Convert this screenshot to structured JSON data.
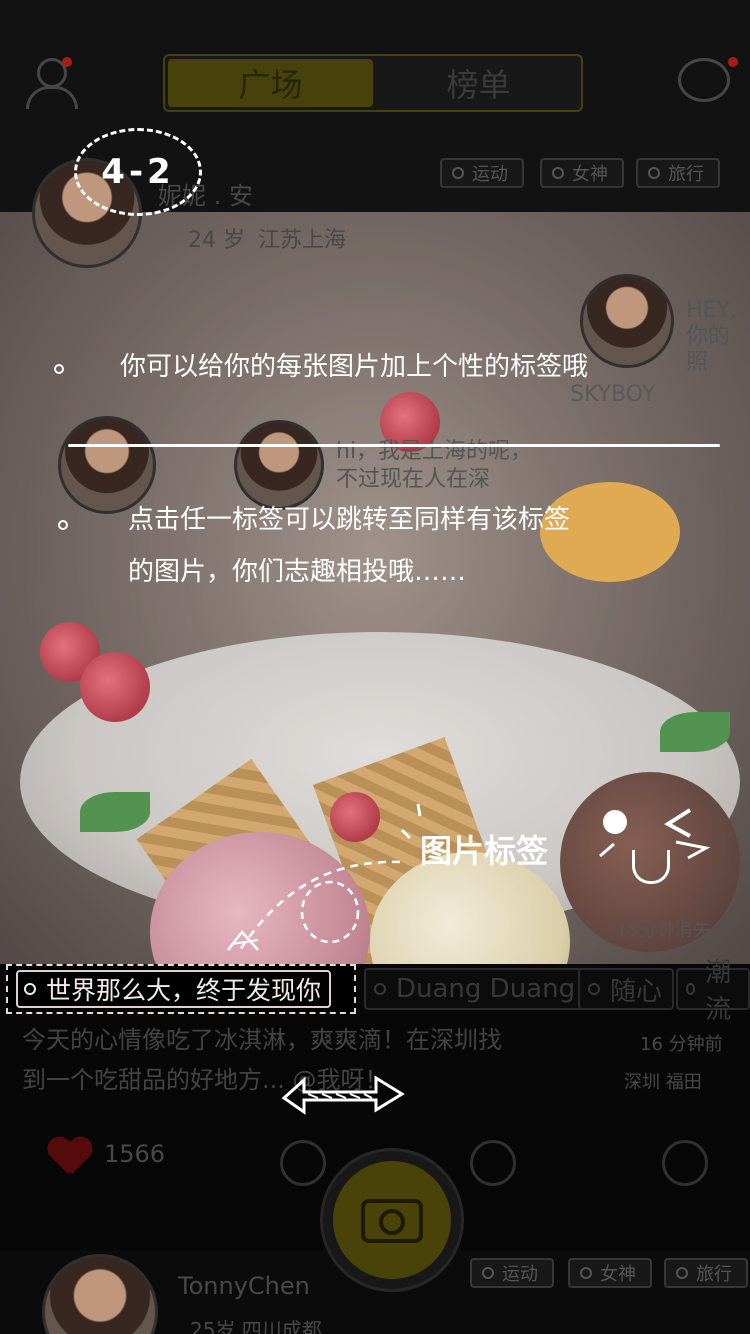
{
  "top_bar": {
    "tabs": [
      "广场",
      "榜单"
    ]
  },
  "post1": {
    "username": "妮妮 . 安",
    "age": "24 岁",
    "location": "江苏上海",
    "tags": [
      "运动",
      "女神",
      "旅行"
    ],
    "photo_label": "SKYBOY",
    "hey_text": "HEY,\n你的照",
    "comment": "hi，我是上海的呢，\n不过现在人在深",
    "expire": "15分钟消失"
  },
  "tag_row": [
    "Duang Duang",
    "随心",
    "潮流"
  ],
  "caption": {
    "text": "今天的心情像吃了冰淇淋，爽爽滴！在深圳找\n到一个吃甜品的好地方... @我呀！",
    "time": "16 分钟前",
    "location": "深圳 福田"
  },
  "actions": {
    "likes": "1566"
  },
  "post2": {
    "username": "TonnyChen",
    "age_location": "25岁   四川成都",
    "tags": [
      "运动",
      "女神",
      "旅行"
    ]
  },
  "guide": {
    "step": "4-2",
    "tip1": "你可以给你的每张图片加上个性的标签哦",
    "tip2_line1": "点击任一标签可以跳转至同样有该标签",
    "tip2_line2": "的图片，你们志趣相投哦……",
    "label_hint": "图片标签",
    "highlighted_tag": "世界那么大，终于发现你"
  },
  "colors": {
    "accent_yellow": "#f0d800",
    "like_red": "#d01010"
  }
}
